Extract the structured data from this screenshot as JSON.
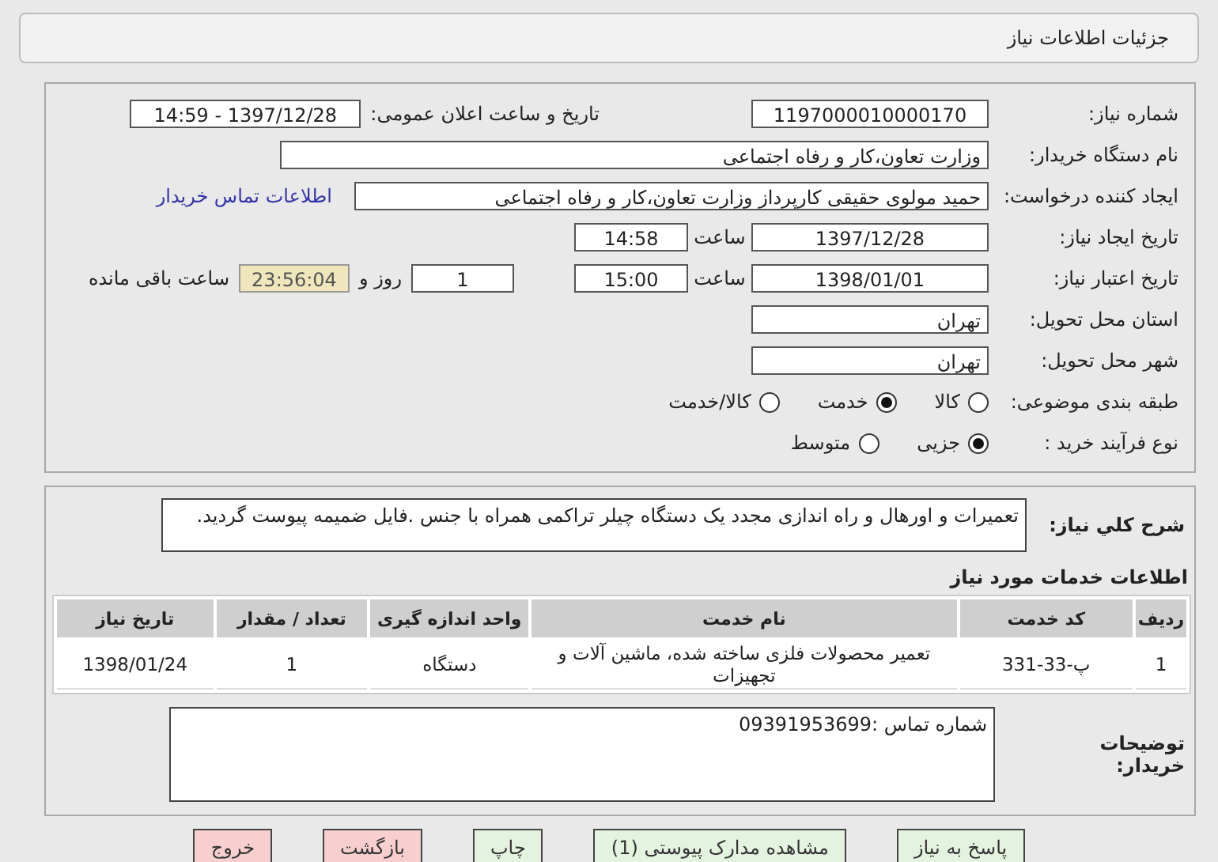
{
  "header": {
    "title": "جزئیات اطلاعات نیاز"
  },
  "need_number": {
    "label": "شماره نیاز:",
    "value": "1197000010000170"
  },
  "announce": {
    "label": "تاریخ و ساعت اعلان عمومی:",
    "value": "1397/12/28 - 14:59"
  },
  "buyer_org": {
    "label": "نام دستگاه خریدار:",
    "value": "وزارت تعاون،کار و رفاه اجتماعی"
  },
  "requester": {
    "label": "ایجاد کننده درخواست:",
    "value": "حمید  مولوی حقیقی کارپرداز وزارت تعاون،کار و رفاه اجتماعی",
    "link": "اطلاعات تماس خریدار"
  },
  "created": {
    "label": "تاریخ ایجاد نیاز:",
    "date": "1397/12/28",
    "time_label": "ساعت",
    "time": "14:58"
  },
  "validity": {
    "label": "تاریخ اعتبار نیاز:",
    "date": "1398/01/01",
    "time_label": "ساعت",
    "time": "15:00",
    "days": "1",
    "days_label": "روز و",
    "remaining": "23:56:04",
    "remaining_label": "ساعت باقی مانده"
  },
  "province": {
    "label": "استان محل تحویل:",
    "value": "تهران"
  },
  "city": {
    "label": "شهر محل تحویل:",
    "value": "تهران"
  },
  "category": {
    "label": "طبقه بندی موضوعی:",
    "options": [
      {
        "label": "کالا",
        "selected": false
      },
      {
        "label": "خدمت",
        "selected": true
      },
      {
        "label": "کالا/خدمت",
        "selected": false
      }
    ]
  },
  "process": {
    "label": "نوع فرآیند خرید :",
    "options": [
      {
        "label": "جزیی",
        "selected": true
      },
      {
        "label": "متوسط",
        "selected": false
      }
    ]
  },
  "description": {
    "label": "شرح کلي نياز:",
    "value": "تعمیرات و اورهال و راه اندازی مجدد یک دستگاه چیلر تراکمی همراه با جنس .فایل ضمیمه پیوست گردید."
  },
  "services": {
    "title": "اطلاعات خدمات مورد نیاز",
    "columns": [
      "ردیف",
      "کد خدمت",
      "نام خدمت",
      "واحد اندازه گیری",
      "تعداد / مقدار",
      "تاریخ نیاز"
    ],
    "rows": [
      [
        "1",
        "پ-33-331",
        "تعمیر محصولات فلزی ساخته شده، ماشین آلات و تجهیزات",
        "دستگاه",
        "1",
        "1398/01/24"
      ]
    ]
  },
  "buyer_notes": {
    "label": "توضیحات خریدار:",
    "value": "شماره تماس :09391953699"
  },
  "buttons": [
    {
      "label": "پاسخ به نیاز",
      "kind": "primary"
    },
    {
      "label": "مشاهده مدارک پیوستی (1)",
      "kind": "primary"
    },
    {
      "label": "چاپ",
      "kind": "primary"
    },
    {
      "label": "بازگشت",
      "kind": "danger"
    },
    {
      "label": "خروج",
      "kind": "danger"
    }
  ]
}
